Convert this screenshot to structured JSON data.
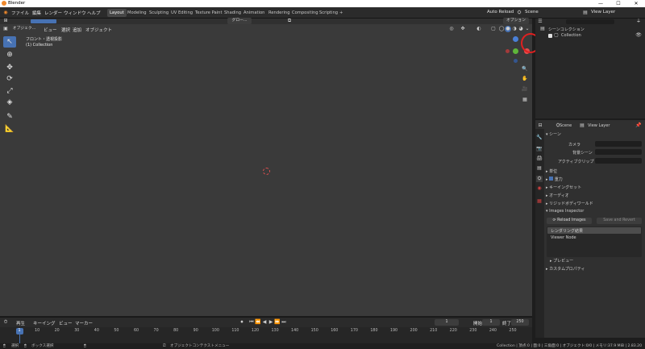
{
  "window": {
    "title": "Blender",
    "min": "—",
    "max": "☐",
    "close": "✕"
  },
  "menubar": {
    "items": [
      "ファイル",
      "編集",
      "レンダー",
      "ウィンドウ",
      "ヘルプ"
    ],
    "workspaces": [
      "Layout",
      "Modeling",
      "Sculpting",
      "UV Editing",
      "Texture Paint",
      "Shading",
      "Animation",
      "Rendering",
      "Compositing",
      "Scripting"
    ],
    "add_tab": "+",
    "auto_reload": "Auto Reload",
    "scene": "Scene",
    "view_layer": "View Layer"
  },
  "viewport": {
    "header_menus": [
      "オブジェク...",
      "ビュー",
      "選択",
      "追加",
      "オブジェクト"
    ],
    "transform": "グロー...",
    "options": "オプション",
    "view_name": "フロント・透視投影",
    "collection_name": "(1) Collection"
  },
  "outliner": {
    "root": "シーンコレクション",
    "collection": "Collection"
  },
  "properties": {
    "scene_label": "Scene",
    "view_layer_label": "View Layer",
    "section_scene": "シーン",
    "camera_label": "カメラ",
    "bg_scene_label": "背景シーン",
    "active_clip_label": "アクティブクリップ",
    "units": "単位",
    "gravity": "重力",
    "keying_sets": "キーイングセット",
    "audio": "オーディオ",
    "rigid_body": "リジッドボディワールド",
    "images_inspector": "Images Inspector",
    "reload_images": "Reload Images",
    "save_and_revert": "Save and Revert",
    "list_item_1": "レンダリング結果",
    "list_item_2": "Viewer Node",
    "preview": "プレビュー",
    "custom_props": "カスタムプロパティ"
  },
  "timeline": {
    "menus": [
      "再生",
      "キーイング",
      "ビュー",
      "マーカー"
    ],
    "current_frame": "1",
    "start_label": "開始",
    "start": "1",
    "end_label": "終了",
    "end": "250",
    "ticks": [
      "1",
      "10",
      "20",
      "30",
      "40",
      "50",
      "60",
      "70",
      "80",
      "90",
      "100",
      "110",
      "120",
      "130",
      "140",
      "150",
      "160",
      "170",
      "180",
      "190",
      "200",
      "210",
      "220",
      "230",
      "240",
      "250"
    ]
  },
  "status": {
    "select": "選択",
    "box_select": "ボックス選択",
    "context_menu": "オブジェクトコンテクストメニュー",
    "info": "Collection | 頂点:0 | 面:0 | 三角面:0 | オブジェクト:0/0 | メモリ:37.9 MiB | 2.83.20"
  },
  "colors": {
    "accent": "#4772b3",
    "annotation": "#e02020",
    "gizmo_x": "#e44d4d",
    "gizmo_y": "#5fb53a",
    "gizmo_z": "#4a7fd6"
  }
}
